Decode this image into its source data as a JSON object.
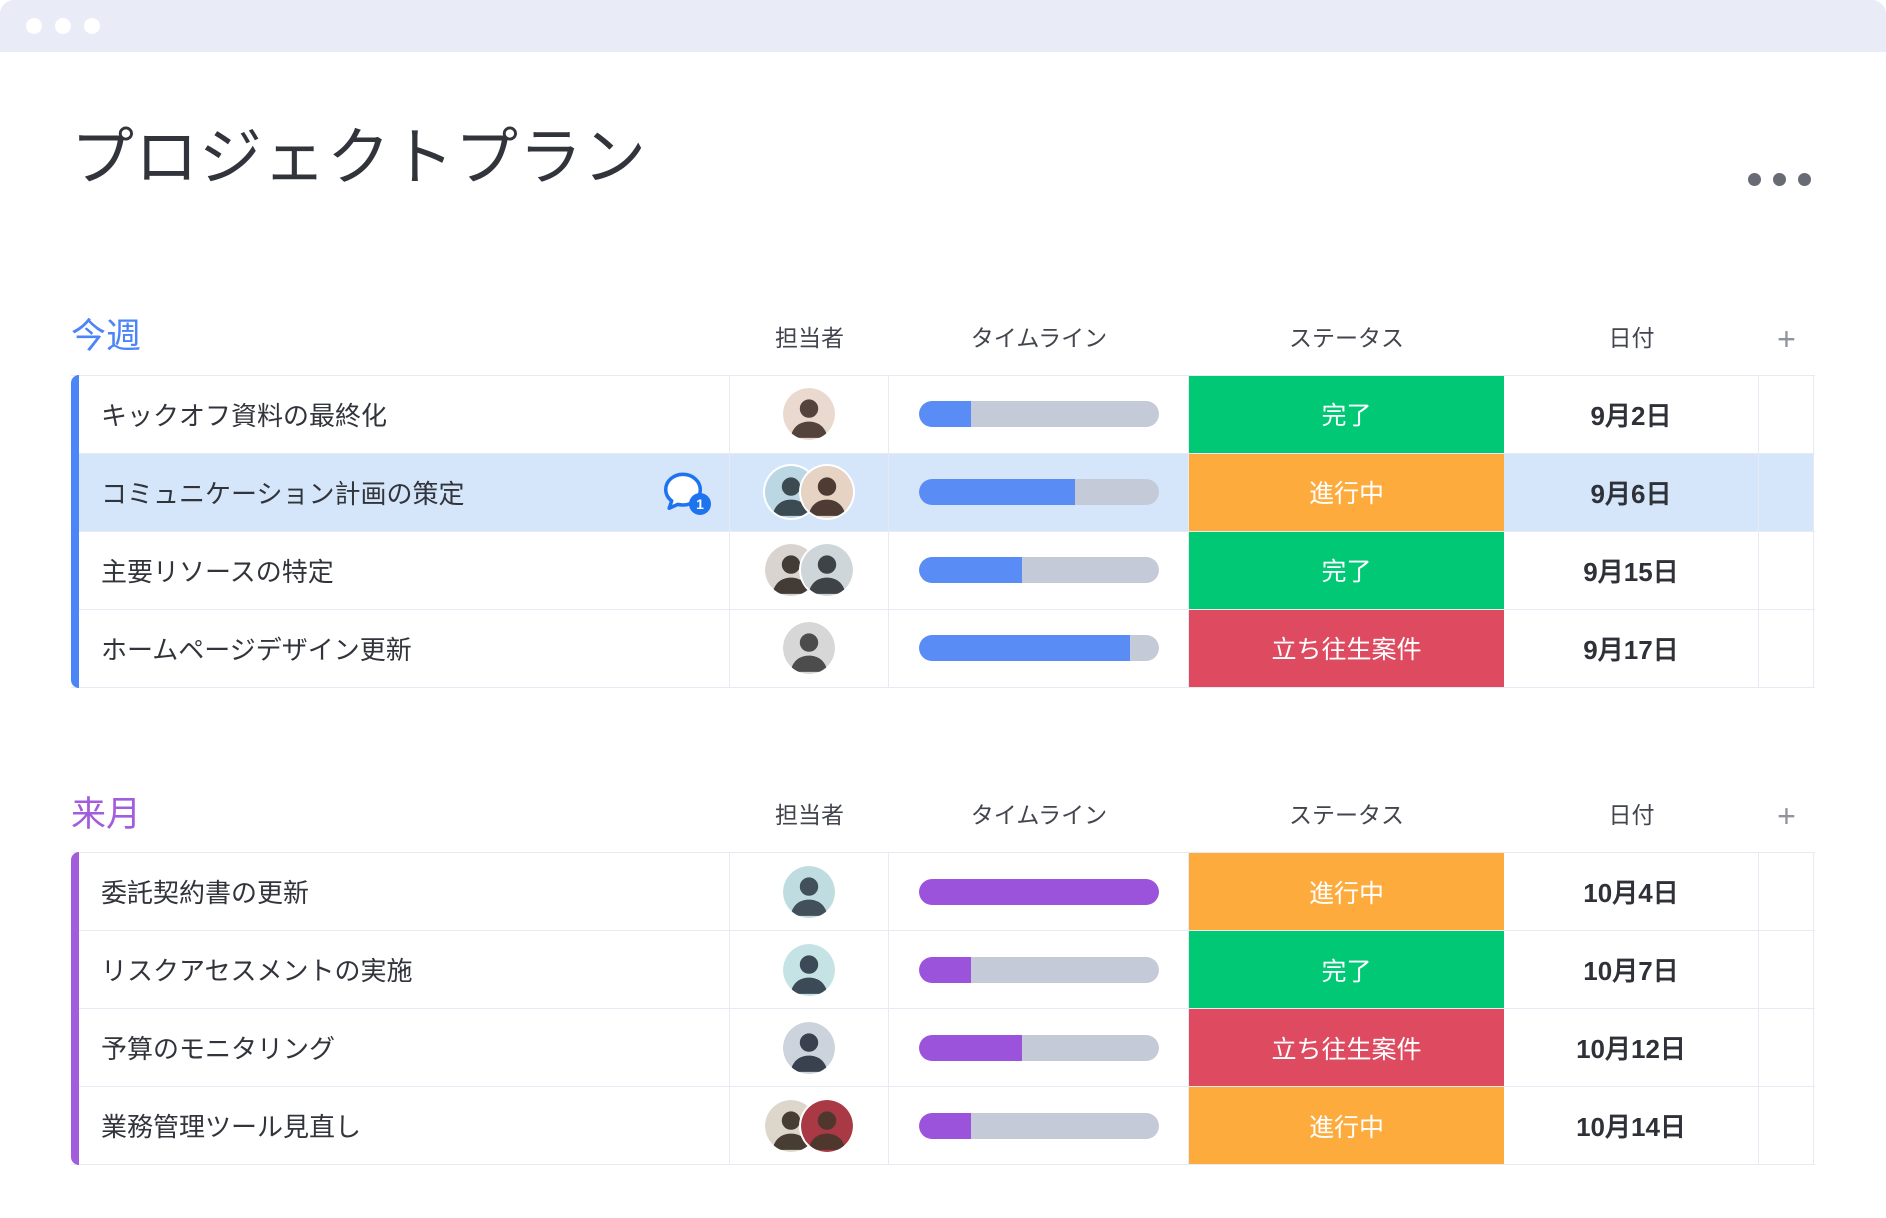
{
  "window": {
    "titlebar_color": "#e9ebf6",
    "control_dots": 3
  },
  "header": {
    "title": "プロジェクトプラン",
    "menu_icon": "ellipsis-icon"
  },
  "columns": {
    "owner": "担当者",
    "timeline": "タイムライン",
    "status": "ステータス",
    "date": "日付",
    "add": "+"
  },
  "colors": {
    "status_done": "#00c875",
    "status_working": "#fdab3d",
    "status_stuck": "#de4b61",
    "timeline_track": "#c5cad8",
    "row_highlight": "#d5e6fa",
    "chat_blue": "#1e74ef"
  },
  "groups": [
    {
      "name": "今週",
      "color": "#4c85f7",
      "bar_fill": "#5a8cf6",
      "rows": [
        {
          "task": "キックオフ資料の最終化",
          "avatars": [
            {
              "bg": "#ead9cf",
              "tone": "#54423c"
            }
          ],
          "progress": 22,
          "status": {
            "label": "完了",
            "color": "#00c875"
          },
          "date": "9月2日",
          "highlighted": false,
          "chat_badge": null
        },
        {
          "task": "コミュニケーション計画の策定",
          "avatars": [
            {
              "bg": "#bcd7e4",
              "tone": "#3c4a52"
            },
            {
              "bg": "#e6d3c4",
              "tone": "#4e3c34"
            }
          ],
          "progress": 65,
          "status": {
            "label": "進行中",
            "color": "#fdab3d"
          },
          "date": "9月6日",
          "highlighted": true,
          "chat_badge": "1"
        },
        {
          "task": "主要リソースの特定",
          "avatars": [
            {
              "bg": "#d9d4cf",
              "tone": "#433b35"
            },
            {
              "bg": "#cfd6da",
              "tone": "#3e4347"
            }
          ],
          "progress": 43,
          "status": {
            "label": "完了",
            "color": "#00c875"
          },
          "date": "9月15日",
          "highlighted": false,
          "chat_badge": null
        },
        {
          "task": "ホームページデザイン更新",
          "avatars": [
            {
              "bg": "#d7d7d7",
              "tone": "#4c4c4c"
            }
          ],
          "progress": 88,
          "status": {
            "label": "立ち往生案件",
            "color": "#de4b61"
          },
          "date": "9月17日",
          "highlighted": false,
          "chat_badge": null
        }
      ]
    },
    {
      "name": "来月",
      "color": "#a25ddc",
      "bar_fill": "#9c53dc",
      "rows": [
        {
          "task": "委託契約書の更新",
          "avatars": [
            {
              "bg": "#bfdde0",
              "tone": "#41505a"
            }
          ],
          "progress": 100,
          "status": {
            "label": "進行中",
            "color": "#fdab3d"
          },
          "date": "10月4日",
          "highlighted": false,
          "chat_badge": null
        },
        {
          "task": "リスクアセスメントの実施",
          "avatars": [
            {
              "bg": "#c5e2e4",
              "tone": "#3b4a56"
            }
          ],
          "progress": 22,
          "status": {
            "label": "完了",
            "color": "#00c875"
          },
          "date": "10月7日",
          "highlighted": false,
          "chat_badge": null
        },
        {
          "task": "予算のモニタリング",
          "avatars": [
            {
              "bg": "#ccd3dd",
              "tone": "#39414f"
            }
          ],
          "progress": 43,
          "status": {
            "label": "立ち往生案件",
            "color": "#de4b61"
          },
          "date": "10月12日",
          "highlighted": false,
          "chat_badge": null
        },
        {
          "task": "業務管理ツール見直し",
          "avatars": [
            {
              "bg": "#ddd6cb",
              "tone": "#473d33"
            },
            {
              "bg": "#a93a45",
              "tone": "#4f372e"
            }
          ],
          "progress": 22,
          "status": {
            "label": "進行中",
            "color": "#fdab3d"
          },
          "date": "10月14日",
          "highlighted": false,
          "chat_badge": null
        }
      ]
    }
  ]
}
